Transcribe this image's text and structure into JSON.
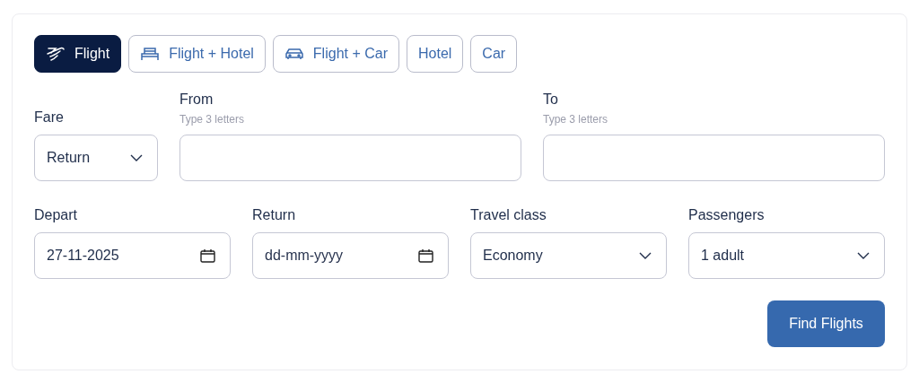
{
  "tabs": [
    {
      "label": "Flight",
      "kind": "plane",
      "selected": true
    },
    {
      "label": "Flight + Hotel",
      "kind": "bed",
      "selected": false
    },
    {
      "label": "Flight + Car",
      "kind": "car",
      "selected": false
    },
    {
      "label": "Hotel",
      "kind": "none",
      "selected": false
    },
    {
      "label": "Car",
      "kind": "none",
      "selected": false
    }
  ],
  "row_1": [
    {
      "kind": "select",
      "label": "Fare",
      "value": "Return"
    },
    {
      "kind": "text",
      "label": "From",
      "hint": "Type 3 letters"
    },
    {
      "kind": "text",
      "label": "To",
      "hint": "Type 3 letters"
    }
  ],
  "row_2": [
    {
      "kind": "date",
      "label": "Depart",
      "value": "27-11-2025"
    },
    {
      "kind": "date",
      "label": "Return",
      "placeholder": "dd-mm-yyyy"
    },
    {
      "kind": "select",
      "label": "Travel class",
      "value": "Economy"
    },
    {
      "kind": "select",
      "label": "Passengers",
      "value": "1 adult"
    }
  ],
  "submit": "Find Flights"
}
